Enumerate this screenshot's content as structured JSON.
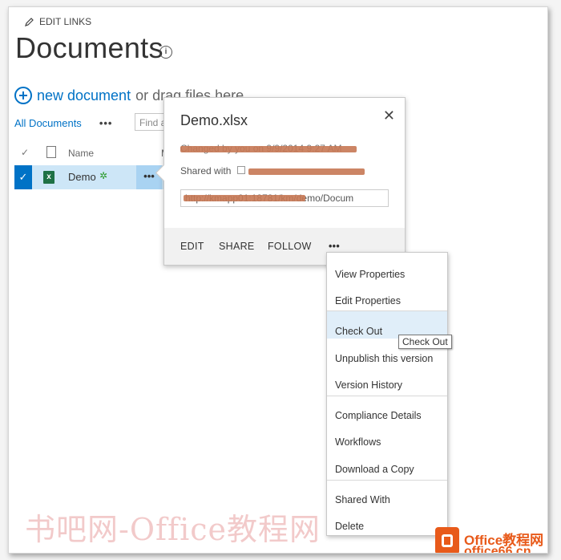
{
  "header": {
    "edit_links": "EDIT LINKS",
    "page_title": "Documents",
    "info_icon": "info-icon"
  },
  "toolbar": {
    "new_document_link": "new document",
    "new_document_rest": "or drag files here"
  },
  "view_bar": {
    "all_documents": "All Documents",
    "more": "•••",
    "find_placeholder": "Find a"
  },
  "list": {
    "columns": [
      "Name",
      "M"
    ],
    "rows": [
      {
        "name": "Demo",
        "type_icon": "excel-icon",
        "new_mark": "✲",
        "selected": true,
        "ellipsis": "•••"
      }
    ]
  },
  "callout": {
    "title": "Demo.xlsx",
    "changed_text": "Changed by you on 9/9/2014 9:27 AM",
    "shared_label": "Shared with",
    "url_text": "http://kmapp01:18781/km/demo/Docum",
    "actions": [
      "EDIT",
      "SHARE",
      "FOLLOW",
      "•••"
    ],
    "close_glyph": "✕"
  },
  "context_menu": {
    "items": [
      "View Properties",
      "Edit Properties",
      "Check Out",
      "Unpublish this version",
      "Version History",
      "Compliance Details",
      "Workflows",
      "Download a Copy",
      "Shared With",
      "Delete"
    ],
    "highlighted": "Check Out"
  },
  "tooltip": "Check Out",
  "watermark": {
    "text": "书吧网-Office教程网",
    "logo_line1": "Office教程网",
    "logo_line2": "office66.cn"
  },
  "colors": {
    "accent": "#0072c6",
    "selection": "#cde6f7",
    "excel": "#1e7145",
    "watermark_brand": "#e85a1a"
  }
}
